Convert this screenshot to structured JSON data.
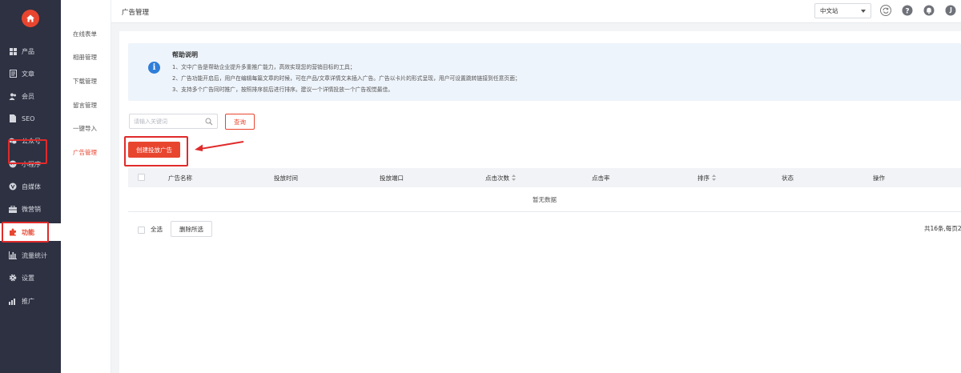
{
  "colors": {
    "brand": "#e8452f",
    "sidebar_bg": "#2d3142",
    "help_bg": "#eef4fb",
    "info": "#2f7ed8",
    "highlight": "#e02a2a"
  },
  "sidebar": {
    "logo_icon": "home-icon",
    "items": [
      {
        "label": "产品",
        "icon": "grid-icon"
      },
      {
        "label": "文章",
        "icon": "document-icon"
      },
      {
        "label": "会员",
        "icon": "users-icon"
      },
      {
        "label": "SEO",
        "icon": "file-icon"
      },
      {
        "label": "公众号",
        "icon": "wechat-icon"
      },
      {
        "label": "小程序",
        "icon": "mini-program-icon"
      },
      {
        "label": "自媒体",
        "icon": "media-icon"
      },
      {
        "label": "微营销",
        "icon": "marketing-icon"
      },
      {
        "label": "功能",
        "icon": "puzzle-icon",
        "active": true
      },
      {
        "label": "流量统计",
        "icon": "bar-chart-icon"
      },
      {
        "label": "设置",
        "icon": "gear-icon"
      },
      {
        "label": "推广",
        "icon": "promote-icon"
      }
    ]
  },
  "subnav": {
    "items": [
      {
        "label": "在线表单"
      },
      {
        "label": "相册管理"
      },
      {
        "label": "下载管理"
      },
      {
        "label": "留言管理"
      },
      {
        "label": "一键导入"
      },
      {
        "label": "广告管理",
        "active": true
      }
    ]
  },
  "topbar": {
    "title": "广告管理",
    "language": "中文站",
    "icons": [
      "refresh-icon",
      "help-icon",
      "bell-icon",
      "user-icon"
    ]
  },
  "help": {
    "title": "帮助说明",
    "lines": [
      "1、文中广告是帮助企业提升多重推广能力，高效实现您的营销目标的工具；",
      "2、广告功能开启后，用户在编辑每篇文章的时候，可在产品/文章详情文末插入广告。广告以卡片的形式呈现，用户可设置跳转链接到任意页面；",
      "3、支持多个广告同时推广，按照排序前后进行排序。建议一个详情投放一个广告视觉最佳。"
    ]
  },
  "search": {
    "placeholder": "请输入关键词",
    "value": ""
  },
  "buttons": {
    "query": "查询",
    "create": "创建投放广告",
    "delete_selected": "删除所选"
  },
  "table": {
    "columns": [
      "广告名称",
      "投放时间",
      "投放端口",
      "点击次数",
      "点击率",
      "排序",
      "状态",
      "操作"
    ],
    "sortable": [
      false,
      false,
      false,
      true,
      false,
      true,
      false,
      false
    ],
    "empty_text": "暂无数据"
  },
  "footer": {
    "select_all": "全选",
    "total_text": "共16条,每页2"
  }
}
